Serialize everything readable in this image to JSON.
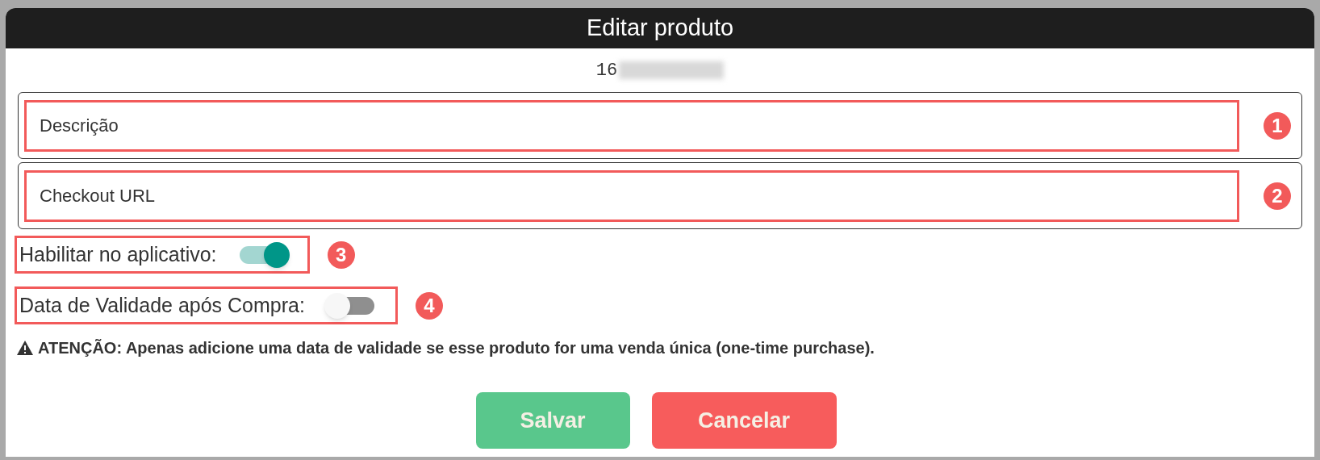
{
  "dialog": {
    "title": "Editar produto",
    "product_id": "16"
  },
  "fields": [
    {
      "placeholder": "Descrição",
      "callout": "1"
    },
    {
      "placeholder": "Checkout URL",
      "callout": "2"
    }
  ],
  "toggles": [
    {
      "label": "Habilitar no aplicativo:",
      "on": true,
      "callout": "3"
    },
    {
      "label": "Data de Validade após Compra:",
      "on": false,
      "callout": "4"
    }
  ],
  "warning": "ATENÇÃO: Apenas adicione uma data de validade se esse produto for uma venda única (one-time purchase).",
  "buttons": [
    {
      "label": "Salvar",
      "kind": "save"
    },
    {
      "label": "Cancelar",
      "kind": "cancel"
    }
  ]
}
